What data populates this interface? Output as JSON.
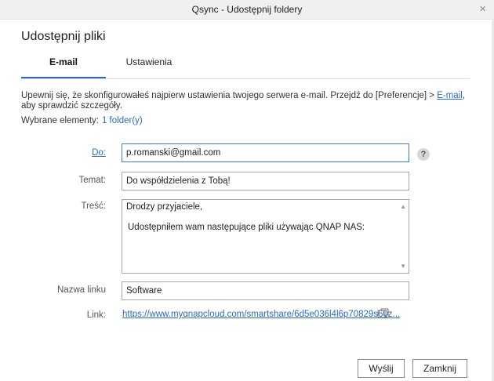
{
  "window": {
    "title": "Qsync - Udostępnij foldery",
    "close_glyph": "×"
  },
  "dialog": {
    "heading": "Udostępnij pliki",
    "tabs": [
      {
        "label": "E-mail",
        "active": true
      },
      {
        "label": "Ustawienia",
        "active": false
      }
    ],
    "notice": {
      "text_before": "Upewnij się, że skonfigurowałeś najpierw ustawienia twojego serwera e-mail. Przejdź do [Preferencje] > ",
      "link": "E-mail",
      "text_after": ", aby sprawdzić szczegóły."
    },
    "selected": {
      "label": "Wybrane elementy:",
      "value": "1 folder(y)"
    }
  },
  "form": {
    "to": {
      "label": "Do:",
      "value": "p.romanski@gmail.com"
    },
    "subject": {
      "label": "Temat:",
      "value": "Do współdzielenia z Tobą!"
    },
    "body": {
      "label": "Treść:",
      "line1": "Drodzy przyjaciele,",
      "line2": "Udostępniłem wam następujące pliki używając QNAP NAS:"
    },
    "link_name": {
      "label": "Nazwa linku",
      "value": "Software"
    },
    "link": {
      "label": "Link:",
      "url": "https://www.myqnapcloud.com/smartshare/6d5e036l4l6p70829s60z..."
    },
    "help_glyph": "?"
  },
  "buttons": {
    "send": "Wyślij",
    "close": "Zamknij"
  },
  "icons": {
    "help": "help-icon",
    "copy": "copy-link-icon",
    "close": "close-icon"
  },
  "colors": {
    "accent": "#2a6ac0",
    "focus_border": "#3a7fd5"
  }
}
